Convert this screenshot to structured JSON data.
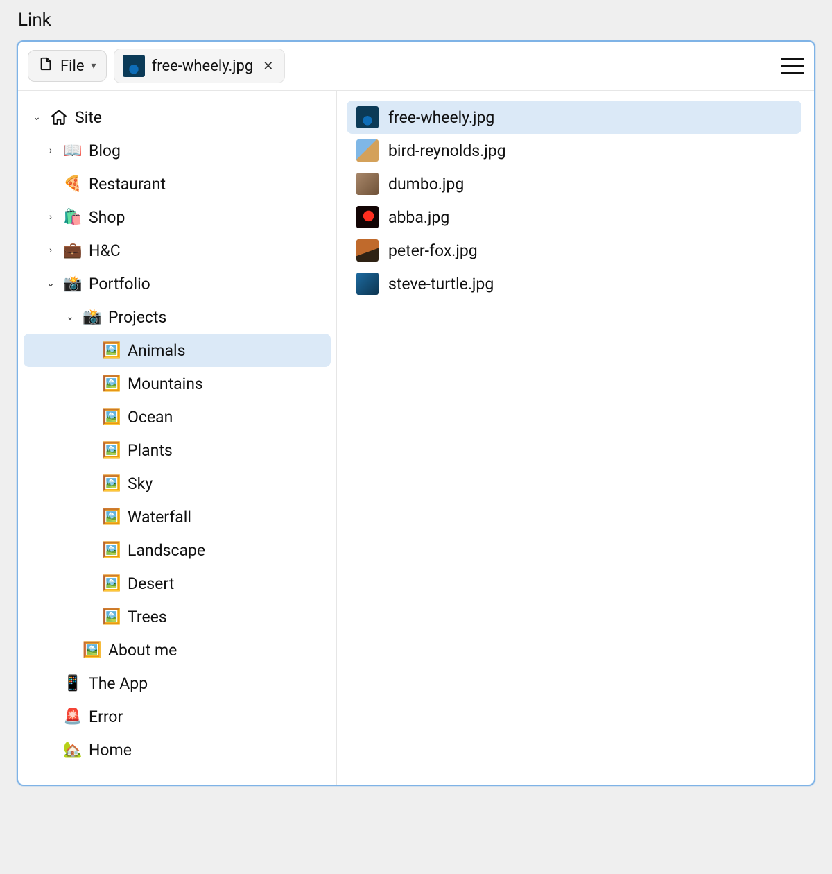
{
  "title": "Link",
  "toolbar": {
    "file_label": "File",
    "tab": {
      "name": "free-wheely.jpg",
      "thumb_class": "th-peacock"
    }
  },
  "tree": [
    {
      "id": "site",
      "label": "Site",
      "depth": 0,
      "toggle": "open",
      "icon": "home",
      "selected": false
    },
    {
      "id": "blog",
      "label": "Blog",
      "depth": 1,
      "toggle": "closed",
      "emoji": "📖",
      "selected": false
    },
    {
      "id": "restaurant",
      "label": "Restaurant",
      "depth": 1,
      "toggle": "none",
      "emoji": "🍕",
      "selected": false
    },
    {
      "id": "shop",
      "label": "Shop",
      "depth": 1,
      "toggle": "closed",
      "emoji": "🛍️",
      "selected": false
    },
    {
      "id": "hc",
      "label": "H&C",
      "depth": 1,
      "toggle": "closed",
      "emoji": "💼",
      "selected": false
    },
    {
      "id": "portfolio",
      "label": "Portfolio",
      "depth": 1,
      "toggle": "open",
      "emoji": "📸",
      "selected": false
    },
    {
      "id": "projects",
      "label": "Projects",
      "depth": 2,
      "toggle": "open",
      "emoji": "📸",
      "selected": false
    },
    {
      "id": "animals",
      "label": "Animals",
      "depth": 3,
      "toggle": "none",
      "emoji": "🖼️",
      "selected": true
    },
    {
      "id": "mountains",
      "label": "Mountains",
      "depth": 3,
      "toggle": "none",
      "emoji": "🖼️",
      "selected": false
    },
    {
      "id": "ocean",
      "label": "Ocean",
      "depth": 3,
      "toggle": "none",
      "emoji": "🖼️",
      "selected": false
    },
    {
      "id": "plants",
      "label": "Plants",
      "depth": 3,
      "toggle": "none",
      "emoji": "🖼️",
      "selected": false
    },
    {
      "id": "sky",
      "label": "Sky",
      "depth": 3,
      "toggle": "none",
      "emoji": "🖼️",
      "selected": false
    },
    {
      "id": "waterfall",
      "label": "Waterfall",
      "depth": 3,
      "toggle": "none",
      "emoji": "🖼️",
      "selected": false
    },
    {
      "id": "landscape",
      "label": "Landscape",
      "depth": 3,
      "toggle": "none",
      "emoji": "🖼️",
      "selected": false
    },
    {
      "id": "desert",
      "label": "Desert",
      "depth": 3,
      "toggle": "none",
      "emoji": "🖼️",
      "selected": false
    },
    {
      "id": "trees",
      "label": "Trees",
      "depth": 3,
      "toggle": "none",
      "emoji": "🖼️",
      "selected": false
    },
    {
      "id": "aboutme",
      "label": "About me",
      "depth": 2,
      "toggle": "none",
      "emoji": "🖼️",
      "selected": false
    },
    {
      "id": "theapp",
      "label": "The App",
      "depth": 1,
      "toggle": "none",
      "emoji": "📱",
      "selected": false
    },
    {
      "id": "error",
      "label": "Error",
      "depth": 1,
      "toggle": "none",
      "emoji": "🚨",
      "selected": false
    },
    {
      "id": "home",
      "label": "Home",
      "depth": 1,
      "toggle": "none",
      "emoji": "🏡",
      "selected": false
    }
  ],
  "files": [
    {
      "name": "free-wheely.jpg",
      "thumb_class": "th-peacock",
      "selected": true
    },
    {
      "name": "bird-reynolds.jpg",
      "thumb_class": "th-bird",
      "selected": false
    },
    {
      "name": "dumbo.jpg",
      "thumb_class": "th-dumbo",
      "selected": false
    },
    {
      "name": "abba.jpg",
      "thumb_class": "th-abba",
      "selected": false
    },
    {
      "name": "peter-fox.jpg",
      "thumb_class": "th-fox",
      "selected": false
    },
    {
      "name": "steve-turtle.jpg",
      "thumb_class": "th-turtle",
      "selected": false
    }
  ]
}
